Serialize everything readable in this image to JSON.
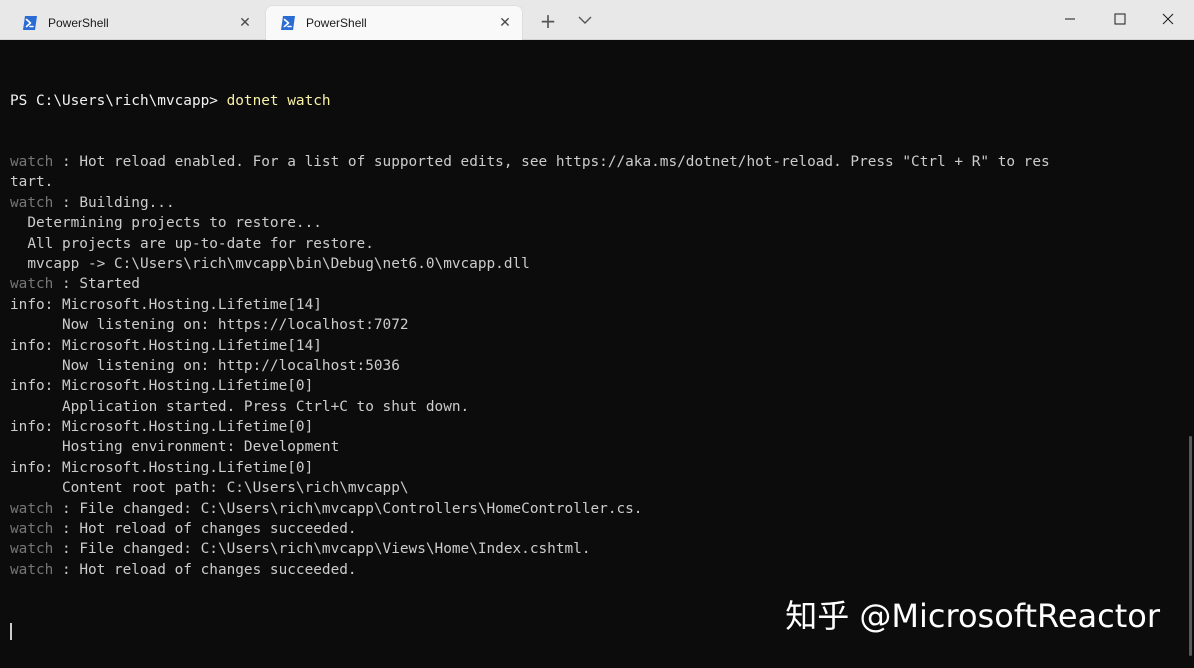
{
  "window": {
    "tabs": [
      {
        "label": "PowerShell",
        "active": false,
        "icon": "powershell-icon"
      },
      {
        "label": "PowerShell",
        "active": true,
        "icon": "powershell-icon"
      }
    ],
    "new_tab_icon": "plus-icon",
    "dropdown_icon": "chevron-down-icon",
    "controls": [
      "minimize-icon",
      "maximize-icon",
      "close-icon"
    ],
    "accent_color": "#2b6cd4",
    "titlebar_color": "#e8e8e8",
    "terminal_background": "#0c0c0c"
  },
  "terminal": {
    "prompt": "PS C:\\Users\\rich\\mvcapp> ",
    "command": "dotnet watch",
    "lines": [
      {
        "prefix": "watch",
        "text": " : Hot reload enabled. For a list of supported edits, see https://aka.ms/dotnet/hot-reload. Press \"Ctrl + R\" to res"
      },
      {
        "prefix": "",
        "text": "tart."
      },
      {
        "prefix": "watch",
        "text": " : Building..."
      },
      {
        "prefix": "",
        "text": "  Determining projects to restore..."
      },
      {
        "prefix": "",
        "text": "  All projects are up-to-date for restore."
      },
      {
        "prefix": "",
        "text": "  mvcapp -> C:\\Users\\rich\\mvcapp\\bin\\Debug\\net6.0\\mvcapp.dll"
      },
      {
        "prefix": "watch",
        "text": " : Started"
      },
      {
        "prefix": "",
        "text": "info: Microsoft.Hosting.Lifetime[14]"
      },
      {
        "prefix": "",
        "text": "      Now listening on: https://localhost:7072"
      },
      {
        "prefix": "",
        "text": "info: Microsoft.Hosting.Lifetime[14]"
      },
      {
        "prefix": "",
        "text": "      Now listening on: http://localhost:5036"
      },
      {
        "prefix": "",
        "text": "info: Microsoft.Hosting.Lifetime[0]"
      },
      {
        "prefix": "",
        "text": "      Application started. Press Ctrl+C to shut down."
      },
      {
        "prefix": "",
        "text": "info: Microsoft.Hosting.Lifetime[0]"
      },
      {
        "prefix": "",
        "text": "      Hosting environment: Development"
      },
      {
        "prefix": "",
        "text": "info: Microsoft.Hosting.Lifetime[0]"
      },
      {
        "prefix": "",
        "text": "      Content root path: C:\\Users\\rich\\mvcapp\\"
      },
      {
        "prefix": "watch",
        "text": " : File changed: C:\\Users\\rich\\mvcapp\\Controllers\\HomeController.cs."
      },
      {
        "prefix": "watch",
        "text": " : Hot reload of changes succeeded."
      },
      {
        "prefix": "watch",
        "text": " : File changed: C:\\Users\\rich\\mvcapp\\Views\\Home\\Index.cshtml."
      },
      {
        "prefix": "watch",
        "text": " : Hot reload of changes succeeded."
      }
    ]
  },
  "watermark": {
    "text": "知乎 @MicrosoftReactor"
  }
}
